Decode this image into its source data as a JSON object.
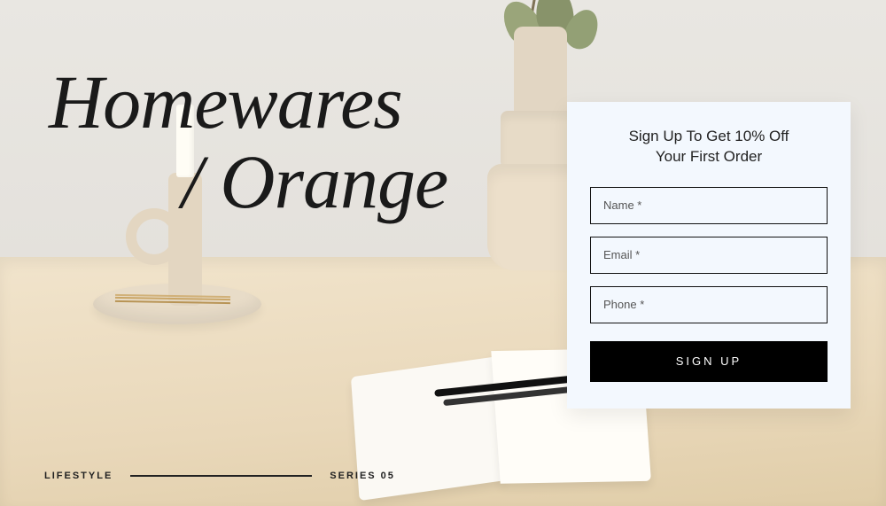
{
  "headline": {
    "line1": "Homewares",
    "line2": "/ Orange"
  },
  "footer": {
    "left": "LIFESTYLE",
    "right": "SERIES 05"
  },
  "signup": {
    "title_line1": "Sign Up To Get 10% Off",
    "title_line2": "Your First Order",
    "name_placeholder": "Name *",
    "email_placeholder": "Email *",
    "phone_placeholder": "Phone *",
    "button_label": "SIGN UP"
  }
}
